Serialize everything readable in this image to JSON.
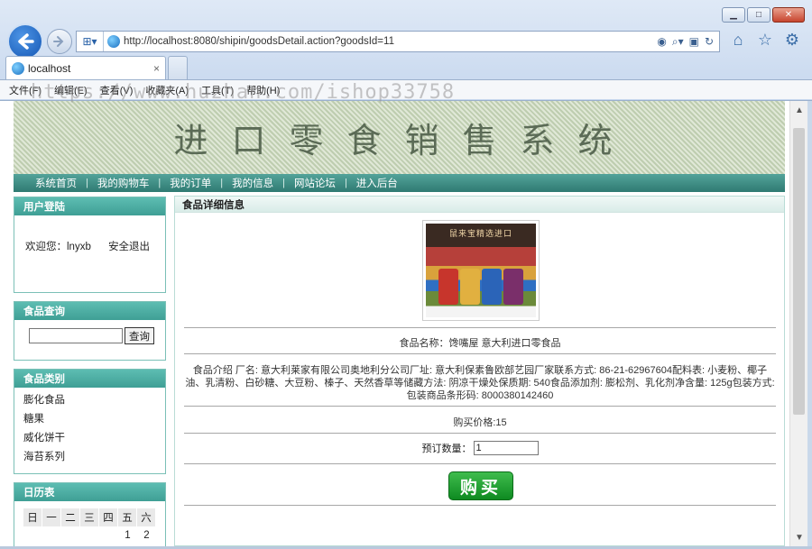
{
  "window": {
    "minimize_glyph": "▁",
    "maximize_glyph": "□",
    "close_glyph": "✕"
  },
  "address_bar": {
    "url": "http://localhost:8080/shipin/goodsDetail.action?goodsId=11"
  },
  "tab": {
    "label": "localhost",
    "close_glyph": "×"
  },
  "menu": [
    "文件(F)",
    "编辑(E)",
    "查看(V)",
    "收藏夹(A)",
    "工具(T)",
    "帮助(H)"
  ],
  "watermark": "https://www.huzhan.com/ishop33758",
  "banner": {
    "title": "进口零食销售系统"
  },
  "nav": [
    "系统首页",
    "我的购物车",
    "我的订单",
    "我的信息",
    "网站论坛",
    "进入后台"
  ],
  "nav_separator": "|",
  "login": {
    "header": "用户登陆",
    "welcome": "欢迎您：lnyxb",
    "logout": "安全退出"
  },
  "search": {
    "header": "食品查询",
    "input_value": "",
    "button": "查询"
  },
  "categories": {
    "header": "食品类别",
    "items": [
      "膨化食品",
      "糖果",
      "威化饼干",
      "海苔系列"
    ]
  },
  "calendar": {
    "header": "日历表",
    "weekdays": [
      "日",
      "一",
      "二",
      "三",
      "四",
      "五",
      "六"
    ],
    "first_row": [
      "",
      "",
      "",
      "",
      "",
      "1",
      "2"
    ]
  },
  "detail": {
    "header": "食品详细信息",
    "image_caption": "鼠来宝精选进口",
    "name_line": "食品名称：馋嘴屋 意大利进口零食品",
    "intro": "食品介绍 厂名: 意大利莱家有限公司奥地利分公司厂址: 意大利保素鲁欧部艺园厂家联系方式: 86-21-62967604配料表: 小麦粉、椰子油、乳清粉、白砂糖、大豆粉、榛子、天然香草等储藏方法: 阴凉干燥处保质期: 540食品添加剂: 膨松剂、乳化剂净含量: 125g包装方式: 包装商品条形码: 8000380142460",
    "price_line": "购买价格:15",
    "qty_label": "预订数量：",
    "qty_value": "1",
    "buy_button": "购买"
  },
  "colors": {
    "nav_bg": "#3f8e85",
    "side_header": "#4fafa4",
    "buy_button": "#1a9a2e",
    "banner_text": "#5b6b56"
  }
}
